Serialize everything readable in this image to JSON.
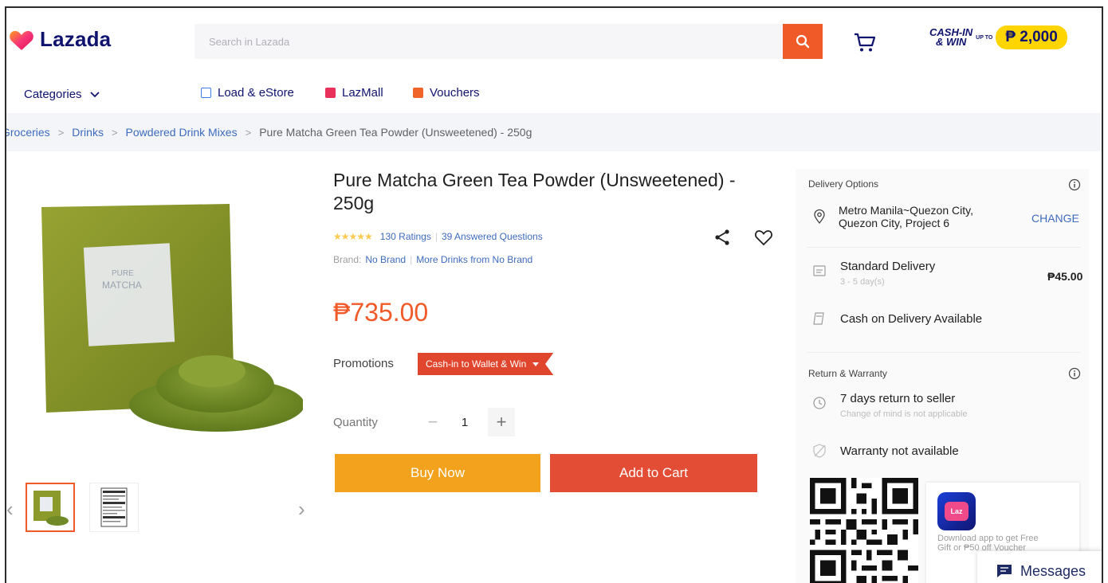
{
  "header": {
    "logo_text": "Lazada",
    "search_placeholder": "Search in Lazada",
    "cashin_line1": "CASH-IN",
    "cashin_line2": "& WIN",
    "cashin_upto": "UP TO",
    "cashin_amount": "₱ 2,000"
  },
  "nav": {
    "categories": "Categories",
    "links": [
      "Load & eStore",
      "LazMall",
      "Vouchers"
    ]
  },
  "breadcrumb": [
    "Groceries",
    "Drinks",
    "Powdered Drink Mixes"
  ],
  "breadcrumb_current": "Pure Matcha Green Tea Powder (Unsweetened) - 250g",
  "product": {
    "title": "Pure Matcha Green Tea Powder (Unsweetened) - 250g",
    "ratings": "130 Ratings",
    "answered": "39 Answered Questions",
    "brand_label": "Brand:",
    "brand": "No Brand",
    "more_from": "More Drinks from No Brand",
    "price": "₱735.00",
    "promotions_label": "Promotions",
    "promo_badge": "Cash-in to Wallet & Win",
    "quantity_label": "Quantity",
    "quantity": "1",
    "buy_now": "Buy Now",
    "add_to_cart": "Add to Cart",
    "package_line1": "PURE",
    "package_line2": "MATCHA"
  },
  "delivery": {
    "heading": "Delivery Options",
    "address": "Metro Manila~Quezon City, Quezon City, Project 6",
    "change": "CHANGE",
    "standard": "Standard Delivery",
    "standard_days": "3 - 5 day(s)",
    "standard_price": "₱45.00",
    "cod": "Cash on Delivery Available"
  },
  "return": {
    "heading": "Return & Warranty",
    "return_title": "7 days return to seller",
    "return_sub": "Change of mind is not applicable",
    "warranty": "Warranty not available"
  },
  "app": {
    "icon_label": "Laz",
    "text": "Download app to get Free Gift or ₱50 off Voucher"
  },
  "messages": "Messages",
  "colors": {
    "brand_navy": "#0f136d",
    "accent_orange": "#f05a28",
    "buy_now": "#f3a21e",
    "add_to_cart": "#e44d35",
    "link_blue": "#3f6bbd"
  }
}
